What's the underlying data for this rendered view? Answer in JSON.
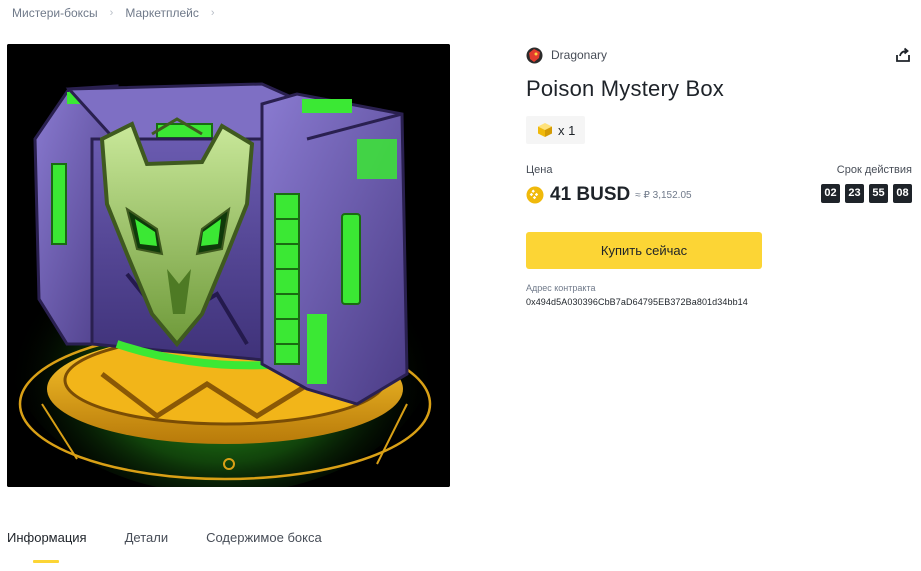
{
  "breadcrumb": {
    "items": [
      "Мистери-боксы",
      "Маркетплейс"
    ]
  },
  "product": {
    "creator": "Dragonary",
    "title": "Poison Mystery Box",
    "quantity": "x 1",
    "price_label": "Цена",
    "price": "41 BUSD",
    "fiat_approx": "≈ ₽ 3,152.05",
    "validity_label": "Срок действия",
    "timer": {
      "days": "02",
      "hours": "23",
      "minutes": "55",
      "seconds": "08"
    },
    "buy_label": "Купить сейчас",
    "contract_label": "Адрес контракта",
    "contract_address": "0x494d5A030396CbB7aD64795EB372Ba801d34bb14"
  },
  "tabs": {
    "info": "Информация",
    "details": "Детали",
    "contents": "Содержимое бокса"
  },
  "colors": {
    "accent": "#fcd535",
    "text": "#1e2329",
    "muted": "#707a8a",
    "box_purple": "#6b5aa8",
    "toxic_green": "#39e636",
    "base_gold": "#e8a317"
  },
  "icons": {
    "share": "share-icon",
    "coin": "busd-coin-icon",
    "quantity": "box-cube-icon",
    "creator": "dragonary-logo"
  }
}
